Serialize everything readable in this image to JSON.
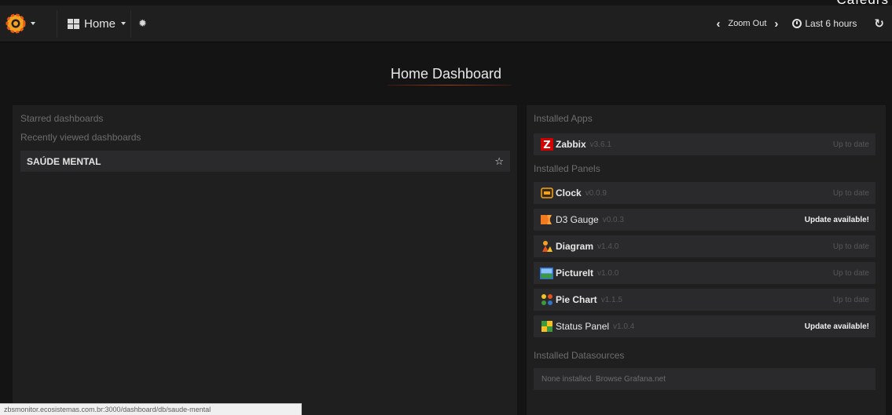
{
  "top_clip_text": "Cafedrs",
  "navbar": {
    "home_label": "Home",
    "zoom_out_label": "Zoom Out",
    "time_range_label": "Last 6 hours",
    "icons": [
      "grafana-logo-icon",
      "dashboards-grid-icon",
      "gear-icon",
      "chevron-left-icon",
      "chevron-right-icon",
      "clock-icon",
      "refresh-icon"
    ]
  },
  "page_title": "Home Dashboard",
  "left_panel": {
    "starred_title": "Starred dashboards",
    "recent_title": "Recently viewed dashboards",
    "recent_items": [
      {
        "label": "SAÚDE MENTAL"
      }
    ]
  },
  "right_panel": {
    "apps_title": "Installed Apps",
    "apps": [
      {
        "name": "Zabbix",
        "version": "v3.6.1",
        "status": "Up to date",
        "icon": "zabbix-icon"
      }
    ],
    "panels_title": "Installed Panels",
    "panels": [
      {
        "name": "Clock",
        "version": "v0.0.9",
        "status": "Up to date",
        "icon": "clock-plugin-icon"
      },
      {
        "name": "D3 Gauge",
        "version": "v0.0.3",
        "status": "Update available!",
        "icon": "d3-icon"
      },
      {
        "name": "Diagram",
        "version": "v1.4.0",
        "status": "Up to date",
        "icon": "diagram-icon"
      },
      {
        "name": "PictureIt",
        "version": "v1.0.0",
        "status": "Up to date",
        "icon": "pictureit-icon"
      },
      {
        "name": "Pie Chart",
        "version": "v1.1.5",
        "status": "Up to date",
        "icon": "pie-chart-icon"
      },
      {
        "name": "Status Panel",
        "version": "v1.0.4",
        "status": "Update available!",
        "icon": "status-panel-icon"
      }
    ],
    "datasources_title": "Installed Datasources",
    "datasources_none": "None installed. Browse Grafana.net"
  },
  "status_bar_url": "zbsmonitor.ecosistemas.com.br:3000/dashboard/db/saude-mental",
  "colors": {
    "background": "#141414",
    "panel": "#1f1f20",
    "row": "#2a2a2c",
    "accent": "#eb7b18"
  }
}
